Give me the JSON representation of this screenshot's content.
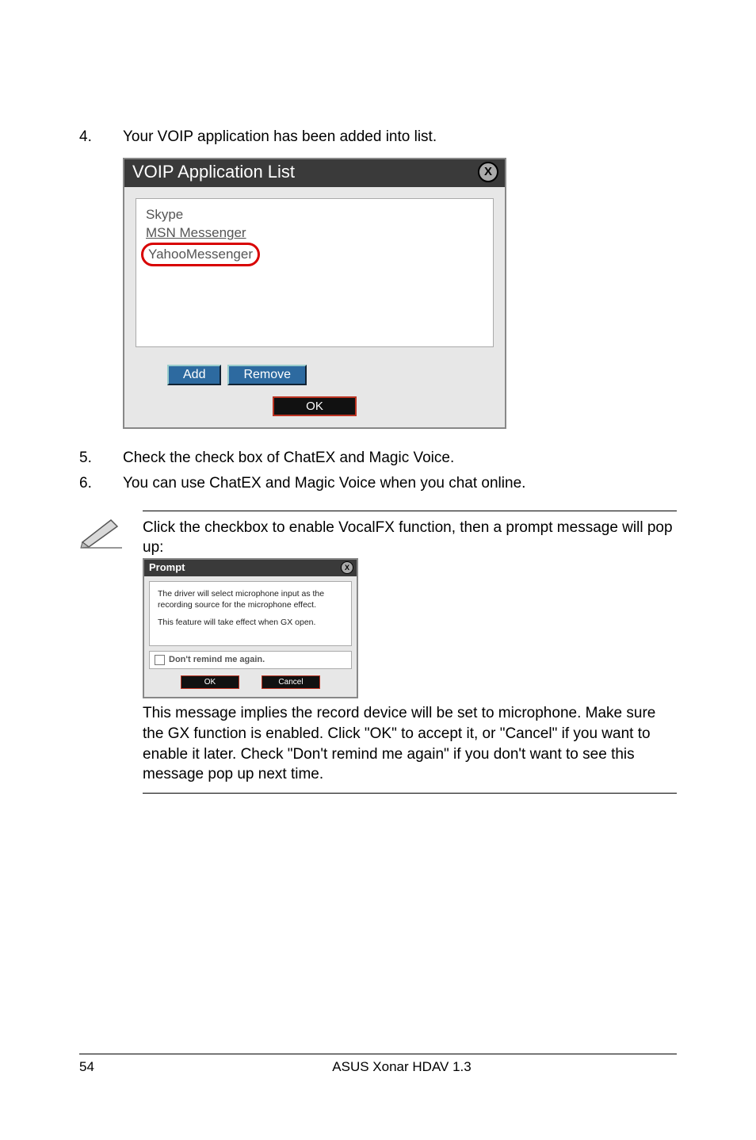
{
  "step4": {
    "num": "4.",
    "text": "Your VOIP application has been added into list."
  },
  "step5": {
    "num": "5.",
    "text": "Check the check box of ChatEX and Magic Voice."
  },
  "step6": {
    "num": "6.",
    "text": "You can use ChatEX and Magic Voice when you chat online."
  },
  "dialog1": {
    "title": "VOIP Application List",
    "items": [
      "Skype",
      "MSN Messenger",
      "YahooMessenger"
    ],
    "add": "Add",
    "remove": "Remove",
    "ok": "OK"
  },
  "note": {
    "line1": "Click the checkbox to enable VocalFX function, then a prompt message will pop up:",
    "after": "This message implies the record device will be set to microphone. Make sure the GX function is enabled. Click \"OK\" to accept it, or \"Cancel\" if you want to enable it later. Check \"Don't remind me again\" if you don't want to see this message pop up next time."
  },
  "dialog2": {
    "title": "Prompt",
    "msg1": "The driver will select microphone input as the recording source for the microphone effect.",
    "msg2": "This feature will take effect when GX open.",
    "remind": "Don't remind me again.",
    "ok": "OK",
    "cancel": "Cancel"
  },
  "footer": {
    "page": "54",
    "title": "ASUS Xonar HDAV 1.3"
  }
}
